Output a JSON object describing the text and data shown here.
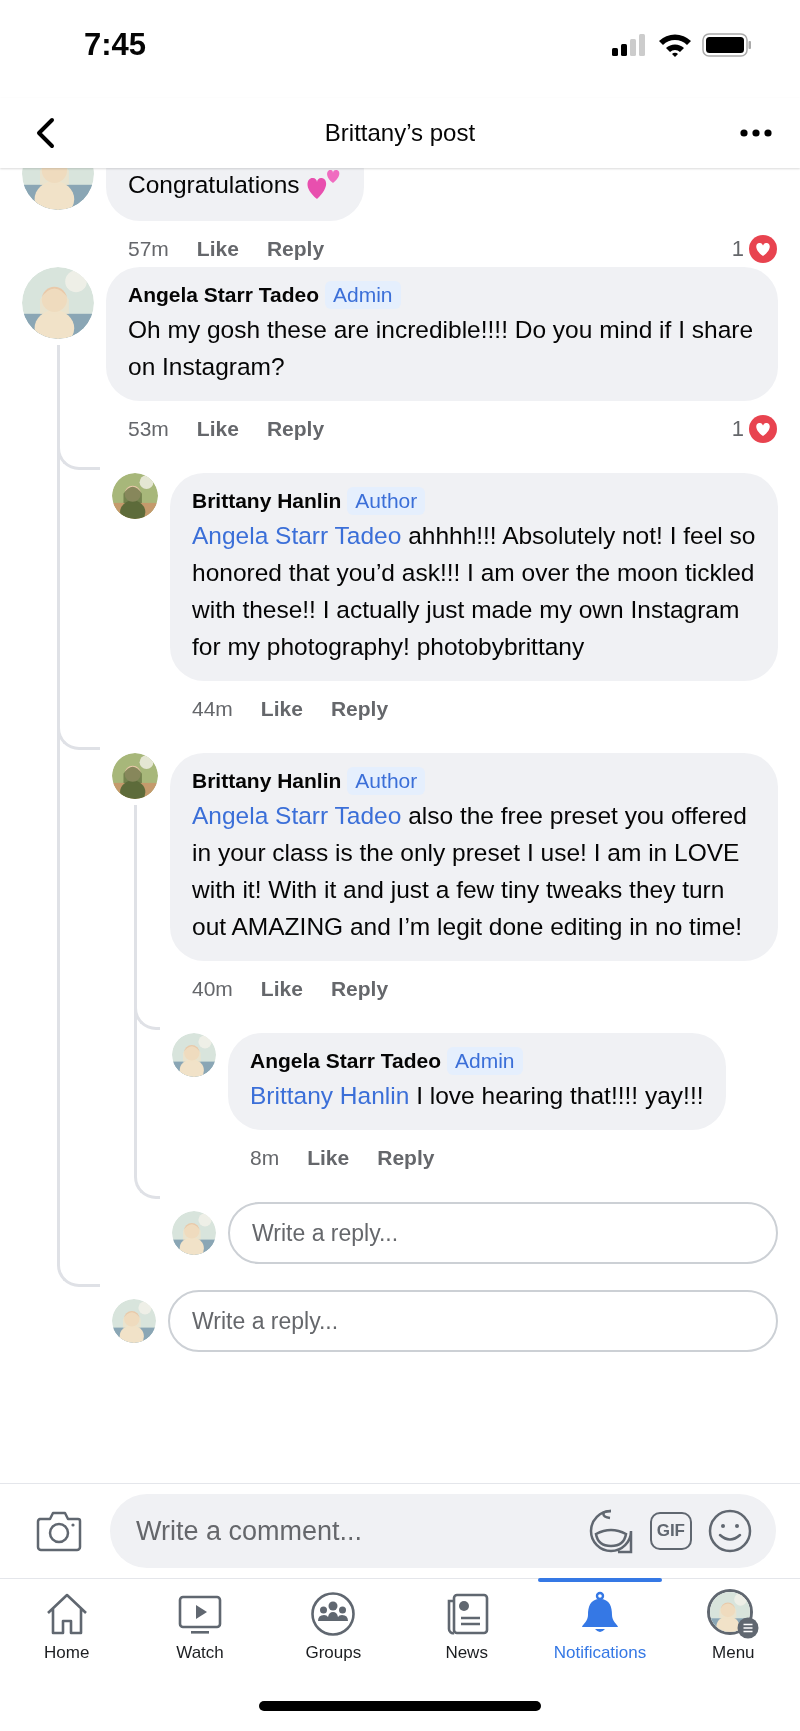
{
  "status_bar": {
    "time": "7:45"
  },
  "header": {
    "title": "Brittany’s post"
  },
  "comments": [
    {
      "text": "Congratulations",
      "time": "57m",
      "like": "Like",
      "reply": "Reply",
      "reactions": "1"
    },
    {
      "author": "Angela Starr Tadeo",
      "badge": "Admin",
      "text": "Oh my gosh these are incredible!!!! Do you mind if I share on Instagram?",
      "time": "53m",
      "like": "Like",
      "reply": "Reply",
      "reactions": "1",
      "children": [
        {
          "author": "Brittany Hanlin",
          "badge": "Author",
          "mention": "Angela Starr Tadeo",
          "text": "ahhhh!!! Absolutely not! I feel so honored that you’d ask!!! I am over the moon tickled with these!! I actually just made my own Instagram for my photography! photobybrittany",
          "time": "44m",
          "like": "Like",
          "reply": "Reply"
        },
        {
          "author": "Brittany Hanlin",
          "badge": "Author",
          "mention": "Angela Starr Tadeo",
          "text": "also the free preset you offered in your class is the only preset I use! I am in LOVE with it! With it and just a few tiny tweaks they turn out AMAZING and I’m legit done editing in no time!",
          "time": "40m",
          "like": "Like",
          "reply": "Reply",
          "children": [
            {
              "author": "Angela Starr Tadeo",
              "badge": "Admin",
              "mention": "Brittany Hanlin",
              "text": "I love hearing that!!!! yay!!!",
              "time": "8m",
              "like": "Like",
              "reply": "Reply"
            }
          ],
          "reply_field": {
            "placeholder": "Write a reply..."
          }
        }
      ],
      "reply_field": {
        "placeholder": "Write a reply..."
      }
    }
  ],
  "composer": {
    "placeholder": "Write a comment...",
    "gif": "GIF"
  },
  "tabs": [
    {
      "label": "Home",
      "selected": false
    },
    {
      "label": "Watch",
      "selected": false
    },
    {
      "label": "Groups",
      "selected": false
    },
    {
      "label": "News",
      "selected": false
    },
    {
      "label": "Notifications",
      "selected": true
    },
    {
      "label": "Menu",
      "selected": false
    }
  ]
}
